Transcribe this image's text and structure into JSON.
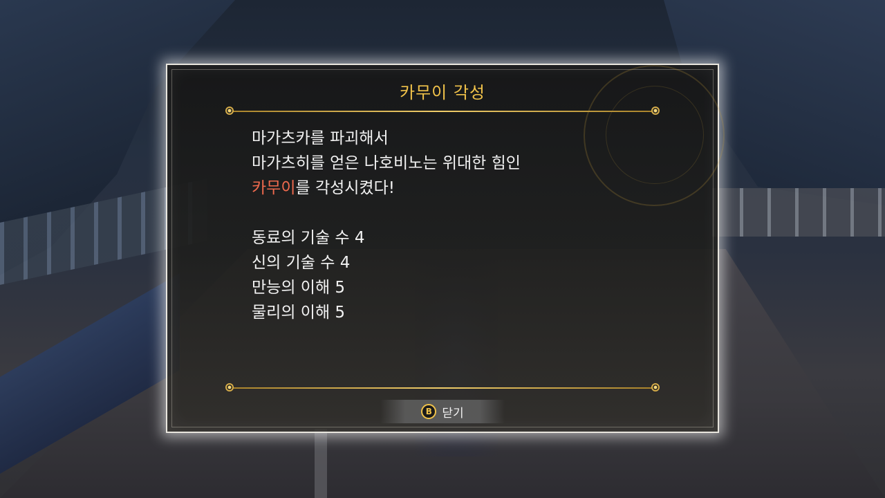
{
  "dialog": {
    "title": "카무이 각성",
    "lines": [
      {
        "text": "마가츠카를 파괴해서"
      },
      {
        "text": "마가츠히를 얻은 나호비노는 위대한 힘인"
      },
      {
        "highlight": "카무이",
        "rest": "를 각성시켰다!"
      }
    ],
    "stats": [
      "동료의 기술 수 4",
      "신의 기술 수 4",
      "만능의 이해 5",
      "물리의 이해 5"
    ],
    "close": {
      "button_glyph": "B",
      "label": "닫기"
    }
  },
  "colors": {
    "title": "#f1c24a",
    "highlight": "#ef6a4e",
    "text": "#f2f2f2",
    "divider": "#f0cd6a"
  }
}
